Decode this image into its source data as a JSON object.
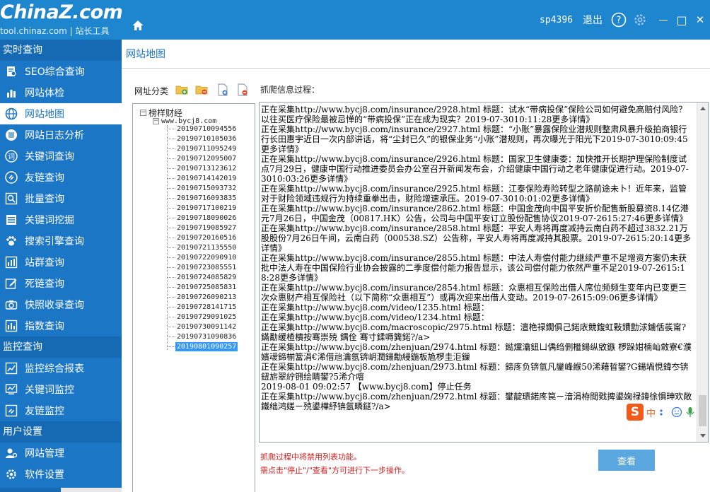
{
  "header": {
    "logo_text": "ChinaZ.com",
    "logo_sub": "tool.chinaz.com | 站长工具",
    "username": "sp4396",
    "logout": "退出",
    "help_glyph": "?",
    "minimize_glyph": "—",
    "maximize_glyph": "□",
    "close_glyph": "✕"
  },
  "sidebar": {
    "groups": [
      {
        "title": "实时查询",
        "items": [
          {
            "label": "SEO综合查询",
            "icon": "seo-icon"
          },
          {
            "label": "网站体检",
            "icon": "bar-chart-icon"
          },
          {
            "label": "网站地图",
            "icon": "globe-icon",
            "active": true
          },
          {
            "label": "网站日志分析",
            "icon": "list-icon"
          },
          {
            "label": "关键词查询",
            "icon": "ci-icon"
          },
          {
            "label": "友链查询",
            "icon": "link-icon"
          },
          {
            "label": "批量查询",
            "icon": "batch-search-icon"
          },
          {
            "label": "关键词挖掘",
            "icon": "list-icon"
          },
          {
            "label": "搜索引擎查询",
            "icon": "paw-icon"
          },
          {
            "label": "站群查询",
            "icon": "stats-icon"
          },
          {
            "label": "死链查询",
            "icon": "edit-icon"
          },
          {
            "label": "快照收录查询",
            "icon": "camera-icon"
          },
          {
            "label": "指数查询",
            "icon": "index-chart-icon"
          }
        ]
      },
      {
        "title": "监控查询",
        "items": [
          {
            "label": "监控综合报表",
            "icon": "report-icon"
          },
          {
            "label": "关键词监控",
            "icon": "monitor-chart-icon"
          },
          {
            "label": "友链监控",
            "icon": "link-icon"
          }
        ]
      },
      {
        "title": "用户设置",
        "items": [
          {
            "label": "网站管理",
            "icon": "user-manage-icon"
          },
          {
            "label": "软件设置",
            "icon": "gear-icon"
          }
        ]
      }
    ]
  },
  "main": {
    "title": "网站地图",
    "category_label": "网址分类",
    "crawl_label": "抓爬信息过程：",
    "tree": {
      "root": "榜样财经",
      "site": "www.bycj8.com",
      "nodes": [
        "20190710094556",
        "20190710105036",
        "20190711095249",
        "20190712095007",
        "20190713123612",
        "20190714142019",
        "20190715093732",
        "20190716093835",
        "20190717100219",
        "20190718090026",
        "20190719085927",
        "20190720160516",
        "20190721135550",
        "20190722090910",
        "20190723085551",
        "20190724085829",
        "20190725085831",
        "20190726090213",
        "20190728141715",
        "20190729091025",
        "20190730091142",
        "20190731090836",
        "20190801090257"
      ],
      "selected_index": 22
    },
    "log_lines": [
      "正在采集http://www.bycj8.com/insurance/2928.html  标题：试水“带病投保”保险公司如何避免高赔付风险？以往买医疗保险最被忌惮的“带病投保”正在成为现实？2019-07-3010:11:28更多详情》",
      "正在采集http://www.bycj8.com/insurance/2927.html  标题：“小账”暴露保险业潜规则整肃风暴升级拍商银行行长田惠宇近日一次内部讲话，将“尘封已久”的银保业务“小账”潜规则，再次曝光于阳光下2019-07-3010:09:45更多详情》",
      "正在采集http://www.bycj8.com/insurance/2926.html  标题：国家卫生健康委：加快推开长期护理保险制度试点7月29日，健康中国行动推进委员会办公室召开新闻发布会，介绍健康中国行动之老年健康促进行动。2019-07-3010:03:26更多详情》",
      "正在采集http://www.bycj8.com/insurance/2925.html  标题：江泰保险寿险转型之路前途未卜！近年来，监管对于财险领域违规行为持续重拳出击，财险增速承压。2019-07-3010:01:02更多详情》",
      "正在采集http://www.bycj8.com/insurance/2862.html  标题：中国金茂向中国平安折价配售新股募资8.14亿港元7月26日，中国金茂（00817.HK）公告，公司与中国平安订立股份配售协议2019-07-2615:27:46更多详情》",
      "正在采集http://www.bycj8.com/insurance/2858.html  标题：平安人寿将再度减持云南白药不超过3832.21万股股份7月26日午间，云南白药（000538.SZ）公告称，平安人寿将再度减持其股票。2019-07-2615:20:14更多详情》",
      "正在采集http://www.bycj8.com/insurance/2855.html  标题：中法人寿偿付能力继续严重不足增资方案仍未获批中法人寿在中国保险行业协会披露的二季度偿付能力报告显示，该公司偿付能力依然严重不足2019-07-2615:18:28更多详情》",
      "正在采集http://www.bycj8.com/insurance/2854.html  标题：众惠相互保险出借人席位频频生变年内已变更三次众惠财产相互保险社（以下简称“众惠相互”）或再次迎来出借人变动。2019-07-2615:09:06更多详情》",
      "正在采集http://www.bycj8.com/video/1235.html  标题：",
      "正在采集http://www.bycj8.com/video/1234.html  标题：",
      "正在采集http://www.bycj8.com/macroscopic/2975.html  标题：澶栬禄鐗俱己鍩庡競鍑虹敤鐨勯浗鐪佸彂甯?鏋勫缓楂樻按骞崇殑  鍝佺  骞寸鍒嗕簨鍩?/a>",
      "正在采集http://www.bycj8.com/zhenjuan/2974.html  标题：鐑爣瀹鈕ㄩ偊绉侀檵鍚纵敓鏃  椤跺姏楠屾敹寮€濮嬪叆鍗椾簹涓€浠借兘瀹氬锛岄潤鍚勪綅鍦板尯椤圭洰鏁  ",
      "正在采集http://www.bycj8.com/zhenjuan/2973.html  标题：鍗庝负锛氫凡鑾峰緱50浠藉晢鐢?G鍚堝悓鍏冭锛鈕旂翠紵铏绘睛鐢?5浠介噾",
      "2019-08-01 09:02:57  【www.bycj8.com】停止任务",
      "正在采集http://www.bycj8.com/zhenjuan/2972.html  标题：鐢靛瓙鍩庝笢ㄧ湆涓栫閲戣捭鍙婅禄鍏徐惧珅欢敞鐵绌鸿嫅ㄧ殑鍙樺紓锛氬疄鎹?/a>"
    ],
    "hint_1": "抓爬过程中将禁用列表功能。",
    "hint_2": "需点击\"停止\"/\"查看\"方可进行下一步操作。",
    "view_button": "查看",
    "ime_s": "S",
    "ime_lang": "中"
  },
  "colors": {
    "topbar": "#1e86cf",
    "sidebar": "#1b76c5",
    "accent": "#1b76c5",
    "hint": "#d42020",
    "button": "#5ba7e0"
  }
}
